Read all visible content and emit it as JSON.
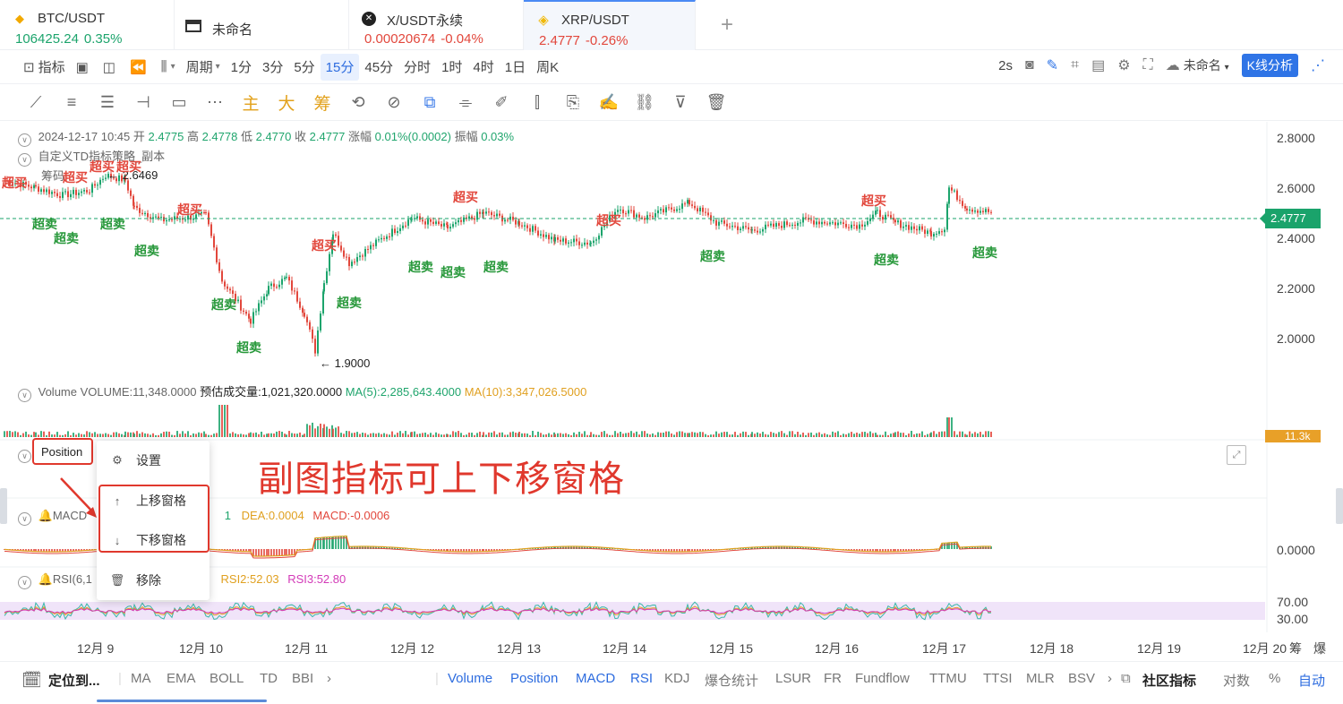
{
  "tabs": [
    {
      "icon": "bitcoin-icon",
      "name": "BTC/USDT",
      "price": "106425.24",
      "change": "0.35%",
      "trend": "up"
    },
    {
      "icon": "layout-icon",
      "name": "未命名",
      "price": "",
      "change": "",
      "trend": ""
    },
    {
      "icon": "x-icon",
      "name": "X/USDT永续",
      "price": "0.00020674",
      "change": "-0.04%",
      "trend": "down"
    },
    {
      "icon": "binance-icon",
      "name": "XRP/USDT",
      "price": "2.4777",
      "change": "-0.26%",
      "trend": "down"
    }
  ],
  "add_tab": "+",
  "toolbar1": {
    "indicators": "指标",
    "period": "周期",
    "intervals": [
      "1分",
      "3分",
      "5分",
      "15分",
      "45分",
      "分时",
      "1时",
      "4时",
      "1日",
      "周K"
    ],
    "active_interval": "15分",
    "refresh": "2s",
    "layout_name": "未命名",
    "kline_analysis": "K线分析"
  },
  "toolbar2": {
    "main": "主",
    "big": "大",
    "chips": "筹"
  },
  "legend": {
    "ohlc": {
      "datetime": "2024-12-17 10:45",
      "open_label": "开",
      "open": "2.4775",
      "high_label": "高",
      "high": "2.4778",
      "low_label": "低",
      "low": "2.4770",
      "close_label": "收",
      "close": "2.4777",
      "change_label": "涨幅",
      "change": "0.01%(0.0002)",
      "amp_label": "振幅",
      "amp": "0.03%"
    },
    "strategy": "自定义TD指标策略_副本",
    "chips_label": "筹码",
    "volume": {
      "name": "Volume",
      "vol": "VOLUME:11,348.0000",
      "est": "预估成交量:1,021,320.0000",
      "ma5": "MA(5):2,285,643.4000",
      "ma10": "MA(10):3,347,026.5000"
    },
    "position": "Position",
    "macd": {
      "name": "MACD",
      "dif_tail": "1",
      "dea": "DEA:0.0004",
      "macd": "MACD:-0.0006"
    },
    "rsi": {
      "name": "RSI(6,1",
      "rsi2": "RSI2:52.03",
      "rsi3": "RSI3:52.80"
    }
  },
  "yaxis": {
    "price": [
      "2.8000",
      "2.6000",
      "2.4000",
      "2.2000",
      "2.0000"
    ],
    "current_price": "2.4777",
    "volume_tag": "11.3k",
    "macd": [
      "0.0000"
    ],
    "rsi": [
      "70.00",
      "30.00"
    ]
  },
  "annotations": {
    "high": "← 2.6469",
    "low": "← 1.9000"
  },
  "signals": {
    "buy": "超买",
    "sell": "超卖"
  },
  "xaxis": [
    "12月 9",
    "12月 10",
    "12月 11",
    "12月 12",
    "12月 13",
    "12月 14",
    "12月 15",
    "12月 16",
    "12月 17",
    "12月 18",
    "12月 19",
    "12月 20"
  ],
  "xaxis_extra": [
    "筹",
    "爆"
  ],
  "context_menu": {
    "settings": "设置",
    "move_up": "上移窗格",
    "move_down": "下移窗格",
    "remove": "移除"
  },
  "callout": "副图指标可上下移窗格",
  "bottombar": {
    "locate": "定位到...",
    "left_items": [
      "MA",
      "EMA",
      "BOLL",
      "TD",
      "BBI"
    ],
    "chevron": "›",
    "indicator_items": [
      "Volume",
      "Position",
      "MACD",
      "RSI"
    ],
    "other_items": [
      "KDJ",
      "爆仓统计",
      "LSUR",
      "FR",
      "Fundflow",
      "TTMU",
      "TTSI",
      "MLR",
      "BSV"
    ],
    "community": "社区指标",
    "log": "对数",
    "percent": "%",
    "auto": "自动"
  },
  "colors": {
    "up": "#1ca46c",
    "down": "#e2473c",
    "accent": "#2f74e6",
    "callout": "#e0382d"
  }
}
